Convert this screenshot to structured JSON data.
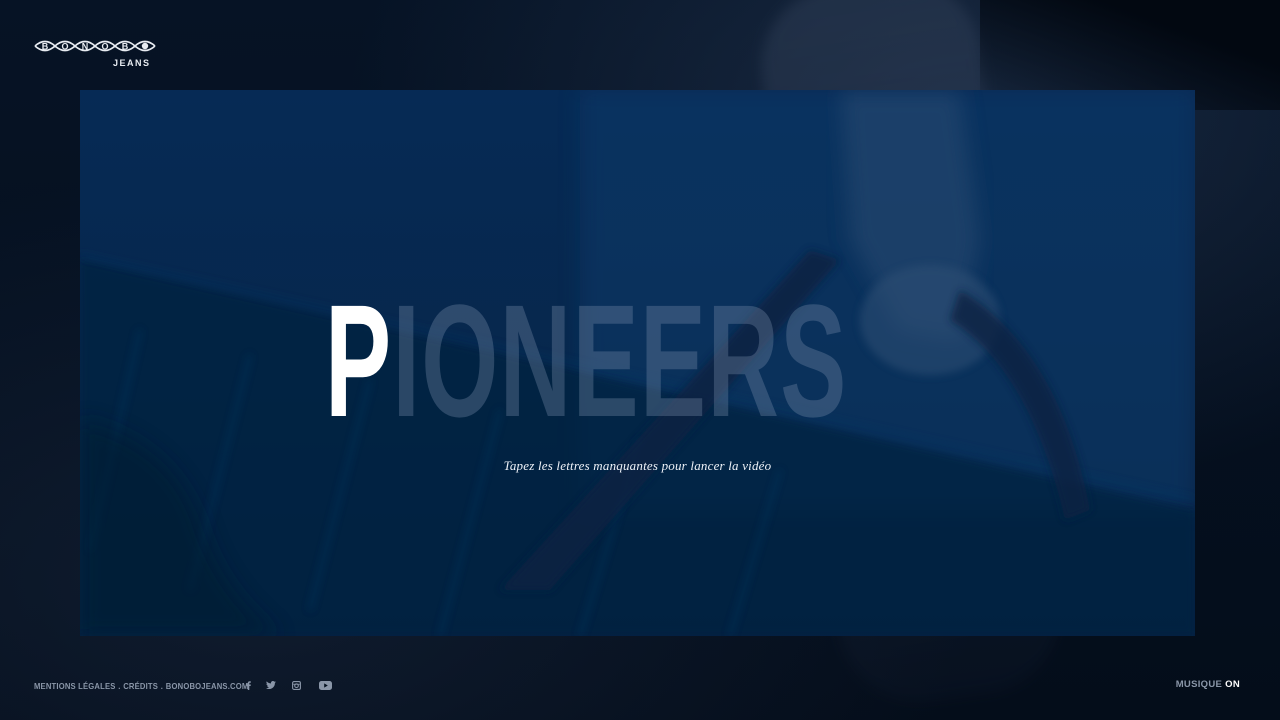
{
  "brand": {
    "name": "BONOBO",
    "sub": "JEANS"
  },
  "hero": {
    "typed_letters": "P",
    "missing_letters": "IONEERS",
    "instruction": "Tapez les lettres manquantes pour lancer la vidéo"
  },
  "footer": {
    "links": [
      {
        "label": "MENTIONS LÉGALES"
      },
      {
        "label": "CRÉDITS"
      },
      {
        "label": "BONOBOJEANS.COM"
      }
    ],
    "separator": ".",
    "social_icons": [
      "facebook-icon",
      "twitter-icon",
      "instagram-icon",
      "youtube-icon"
    ]
  },
  "music": {
    "label": "MUSIQUE",
    "state": "ON"
  },
  "colors": {
    "background": "#04101f",
    "panel": "#062a55",
    "text_primary": "#ffffff",
    "text_muted": "#8a96a8"
  }
}
